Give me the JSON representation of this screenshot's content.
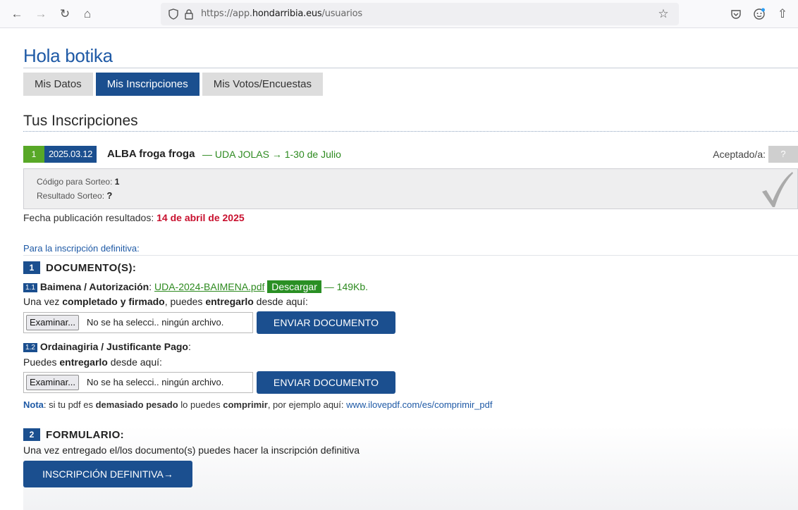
{
  "browser": {
    "url_prefix": "https://app.",
    "url_domain": "hondarribia.eus",
    "url_path": "/usuarios"
  },
  "greeting": "Hola botika",
  "tabs": [
    {
      "label": "Mis Datos",
      "active": false
    },
    {
      "label": "Mis Inscripciones",
      "active": true
    },
    {
      "label": "Mis Votos/Encuestas",
      "active": false
    }
  ],
  "section_title": "Tus Inscripciones",
  "inscription": {
    "number": "1",
    "date": "2025.03.12",
    "name": "ALBA froga froga",
    "meta_dash": "—",
    "meta_program": "UDA JOLAS",
    "meta_arrow": "→",
    "meta_dates": "1-30 de Julio",
    "accepted_label": "Aceptado/a:",
    "accepted_value": "?"
  },
  "sorteo": {
    "code_label": "Código para Sorteo:",
    "code_value": "1",
    "result_label": "Resultado Sorteo:",
    "result_value": "?"
  },
  "fecha": {
    "label": "Fecha publicación resultados:",
    "value": "14 de abril de 2025"
  },
  "definitive_heading": "Para la inscripción definitiva:",
  "documents": {
    "step_num": "1",
    "step_title": "DOCUMENTO(S):",
    "doc1": {
      "num": "1.1",
      "title": "Baimena / Autorización",
      "file_link": "UDA-2024-BAIMENA.pdf",
      "download_label": "Descargar",
      "size": "— 149Kb."
    },
    "doc1_instruction": {
      "a": "Una vez ",
      "b": "completado y firmado",
      "c": ", puedes ",
      "d": "entregarlo",
      "e": " desde aquí:"
    },
    "doc2": {
      "num": "1.2",
      "title": "Ordainagiria / Justificante Pago"
    },
    "doc2_instruction": {
      "a": "Puedes ",
      "b": "entregarlo",
      "c": " desde aquí:"
    },
    "file_button": "Examinar...",
    "file_placeholder": "No se ha selecci.. ningún archivo.",
    "send_button": "ENVIAR DOCUMENTO"
  },
  "nota": {
    "title": "Nota",
    "a": ": si tu pdf es ",
    "b": "demasiado pesado",
    "c": " lo puedes ",
    "d": "comprimir",
    "e": ", por ejemplo aquí: ",
    "link": "www.ilovepdf.com/es/comprimir_pdf"
  },
  "form": {
    "step_num": "2",
    "step_title": "FORMULARIO:",
    "description": "Una vez entregado el/los documento(s) puedes hacer la inscripción definitiva",
    "button": "INSCRIPCIÓN DEFINITIVA→"
  },
  "colors": {
    "primary": "#1b4f8f",
    "green": "#58a827",
    "red": "#c8102e"
  }
}
